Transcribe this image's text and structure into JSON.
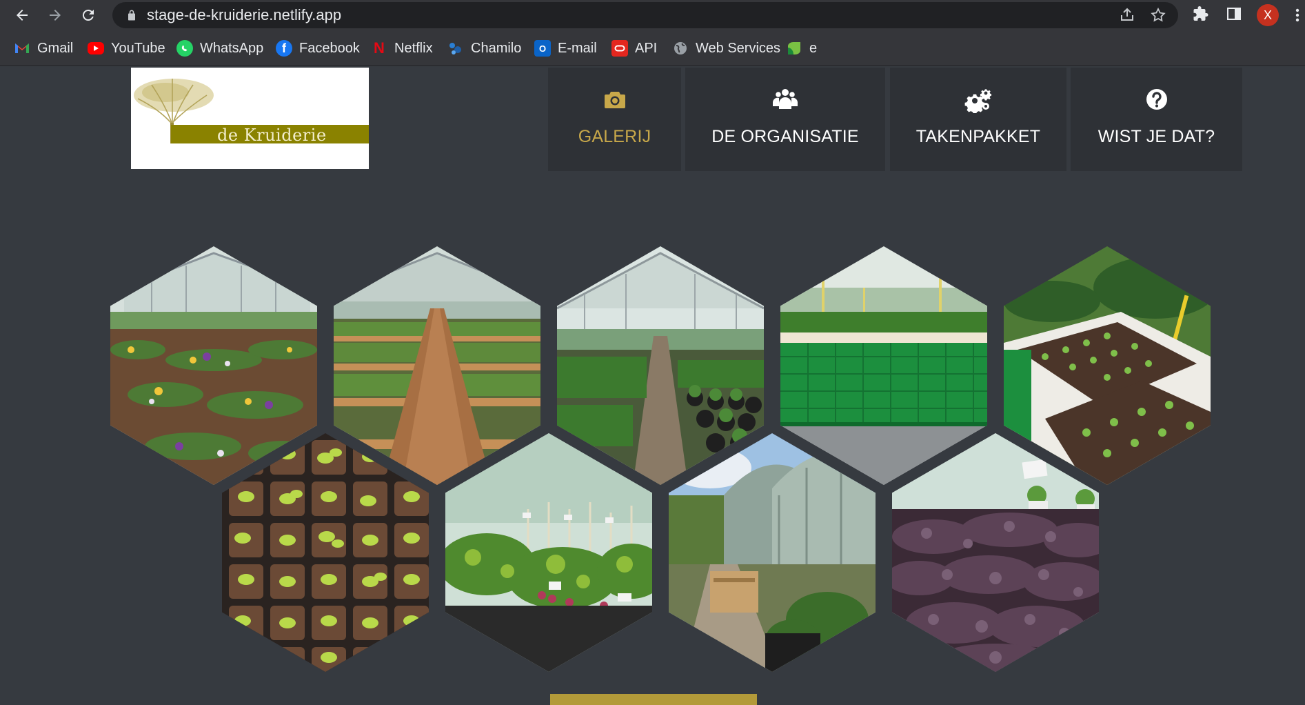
{
  "browser": {
    "url": "stage-de-kruiderie.netlify.app",
    "profile_initial": "X",
    "icons": {
      "back": "arrow-left-icon",
      "forward": "arrow-right-icon",
      "reload": "reload-icon",
      "lock": "lock-icon",
      "share": "share-icon",
      "bookmark": "star-icon",
      "extensions": "puzzle-icon",
      "sidepanel": "side-panel-icon",
      "menu": "more-vert-icon"
    }
  },
  "bookmarks": [
    {
      "label": "Gmail",
      "icon": "gmail-icon",
      "color": "#ea4335"
    },
    {
      "label": "YouTube",
      "icon": "youtube-icon",
      "color": "#ff0000"
    },
    {
      "label": "WhatsApp",
      "icon": "whatsapp-icon",
      "color": "#25d366"
    },
    {
      "label": "Facebook",
      "icon": "facebook-icon",
      "color": "#1877f2"
    },
    {
      "label": "Netflix",
      "icon": "netflix-icon",
      "color": "#e50914"
    },
    {
      "label": "Chamilo",
      "icon": "chamilo-icon",
      "color": "#2a7fd4"
    },
    {
      "label": "E-mail",
      "icon": "outlook-icon",
      "color": "#0a64c8"
    },
    {
      "label": "API",
      "icon": "oracle-icon",
      "color": "#e4271f"
    },
    {
      "label": "Web Services",
      "icon": "globe-icon",
      "color": "#9aa0a6"
    },
    {
      "label": "e",
      "icon": "app-icon",
      "color": "#7ac143"
    }
  ],
  "site": {
    "logo_text": "de Kruiderie",
    "accent": "#c8a84a",
    "nav": [
      {
        "label": "GALERIJ",
        "icon": "camera-icon",
        "active": true
      },
      {
        "label": "DE ORGANISATIE",
        "icon": "users-icon",
        "active": false
      },
      {
        "label": "TAKENPAKKET",
        "icon": "gears-icon",
        "active": false
      },
      {
        "label": "WIST JE DAT?",
        "icon": "question-circle-icon",
        "active": false
      }
    ],
    "gallery_count": 9
  }
}
